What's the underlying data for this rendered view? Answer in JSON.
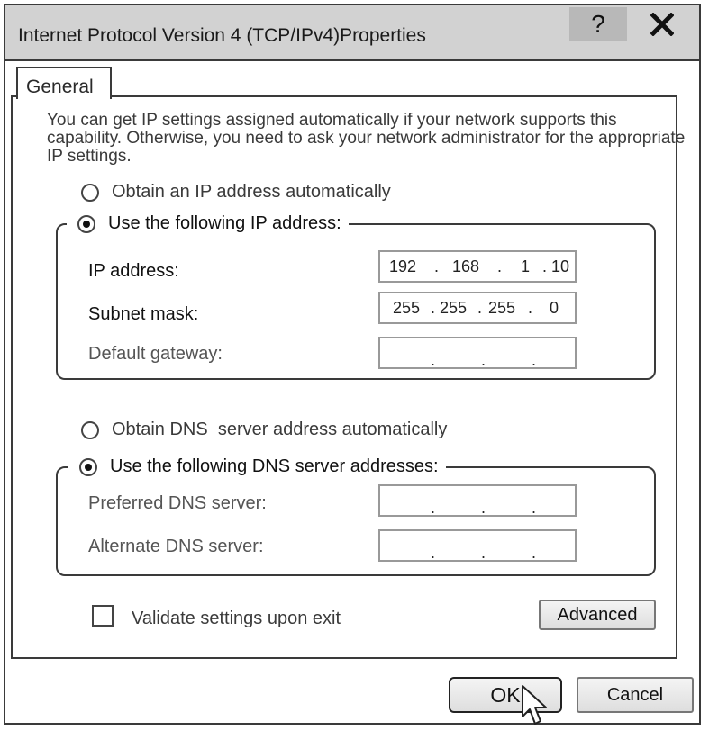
{
  "window": {
    "title": "Internet Protocol Version 4 (TCP/IPv4)Properties",
    "help_label": "?",
    "close_icon": "close-icon"
  },
  "tabs": [
    {
      "label": "General"
    }
  ],
  "intro_text": "You can get IP settings assigned automatically if your network supports this capability. Otherwise, you need to ask your network administrator for the appropriate IP settings.",
  "ip_section": {
    "auto_label": "Obtain an IP address automatically",
    "manual_label": "Use the following IP address:",
    "selected": "manual",
    "fields": [
      {
        "label": "IP address:",
        "octets": [
          "192",
          "168",
          "1",
          "10"
        ]
      },
      {
        "label": "Subnet mask:",
        "octets": [
          "255",
          "255",
          "255",
          "0"
        ]
      },
      {
        "label": "Default gateway:",
        "octets": [
          "",
          "",
          "",
          ""
        ]
      }
    ]
  },
  "dns_section": {
    "auto_label": "Obtain DNS  server address automatically",
    "manual_label": "Use the following DNS server addresses:",
    "selected": "manual",
    "fields": [
      {
        "label": "Preferred DNS server:",
        "octets": [
          "",
          "",
          "",
          ""
        ]
      },
      {
        "label": "Alternate DNS server:",
        "octets": [
          "",
          "",
          "",
          ""
        ]
      }
    ]
  },
  "validate": {
    "label": "Validate settings upon exit",
    "checked": false
  },
  "buttons": {
    "advanced": "Advanced",
    "ok": "OK",
    "cancel": "Cancel"
  },
  "colors": {
    "titlebar": "#d2d2d2",
    "help_button": "#b8b8b8",
    "border": "#3a3a3a"
  }
}
